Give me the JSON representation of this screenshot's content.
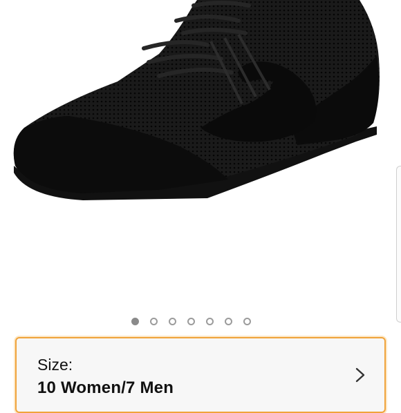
{
  "product": {
    "image_icon": "dance-sneaker-image",
    "gallery": {
      "page_count": 7,
      "active_index": 0
    }
  },
  "size_selector": {
    "label": "Size:",
    "value": "10 Women/7 Men",
    "chevron_icon": "chevron-right-icon",
    "accent_color": "#f0a33b"
  }
}
